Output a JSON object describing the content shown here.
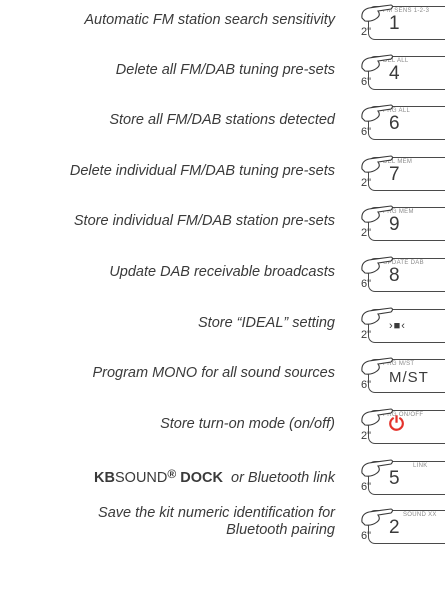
{
  "rows": [
    {
      "desc": "Automatic FM station search sensitivity",
      "secs": "2\"",
      "small": "FM SENS 1-2-3",
      "big": "1"
    },
    {
      "desc": "Delete all FM/DAB tuning pre-sets",
      "secs": "6\"",
      "small": "DEL ALL",
      "big": "4"
    },
    {
      "desc": "Store all FM/DAB stations detected",
      "secs": "6\"",
      "small": "PRG ALL",
      "big": "6"
    },
    {
      "desc": "Delete individual FM/DAB tuning pre-sets",
      "secs": "2\"",
      "small": "DEL MEM",
      "big": "7"
    },
    {
      "desc": "Store individual FM/DAB station pre-sets",
      "secs": "2\"",
      "small": "PRG MEM",
      "big": "9"
    },
    {
      "desc": "Update DAB receivable broadcasts",
      "secs": "6\"",
      "small": "UPDATE DAB",
      "big": "8"
    },
    {
      "desc": "Store “IDEAL” setting",
      "secs": "2\"",
      "small": "",
      "big": "›■‹"
    },
    {
      "desc": "Program MONO for all sound sources",
      "secs": "6\"",
      "small": "PRG M/ST",
      "big": "M/ST"
    },
    {
      "desc": "Store turn-on mode (on/off)",
      "secs": "2\"",
      "small": "PRG ON/OFF",
      "big": "⏻"
    },
    {
      "desc_kb": "KB",
      "desc_sound": "SOUND",
      "desc_reg": "®",
      "desc_dock": " DOCK",
      "desc_tail": "  or Bluetooth link",
      "secs": "6\"",
      "small": "LINK",
      "big": "5"
    },
    {
      "desc_l1": "Save the kit numeric identification for",
      "desc_l2": "Bluetooth pairing",
      "secs": "6\"",
      "small": "SOUND XX",
      "big": "2"
    }
  ]
}
